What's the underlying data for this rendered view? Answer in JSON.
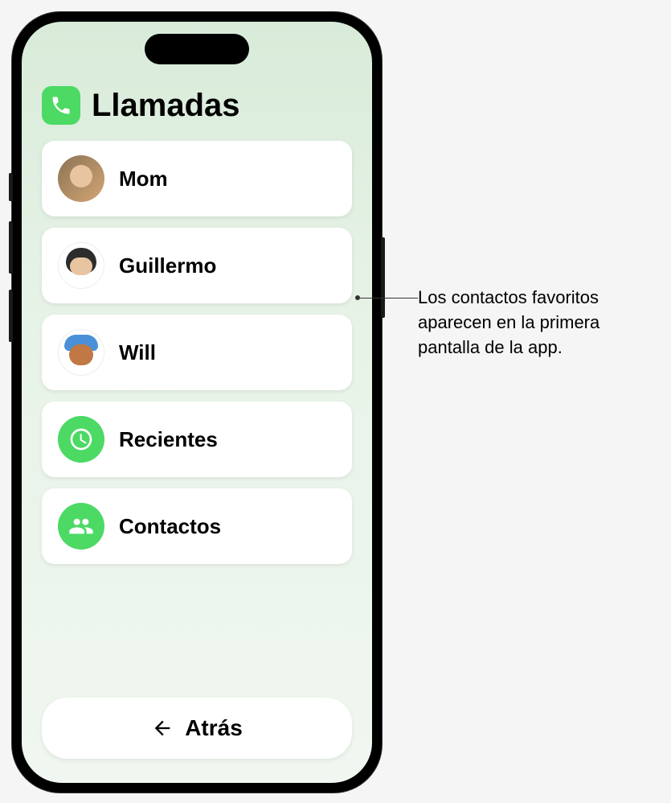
{
  "header": {
    "title": "Llamadas"
  },
  "favorites": [
    {
      "name": "Mom",
      "avatar_type": "photo"
    },
    {
      "name": "Guillermo",
      "avatar_type": "memoji"
    },
    {
      "name": "Will",
      "avatar_type": "memoji"
    }
  ],
  "actions": {
    "recents": {
      "label": "Recientes",
      "icon": "clock"
    },
    "contacts": {
      "label": "Contactos",
      "icon": "people"
    }
  },
  "back": {
    "label": "Atrás"
  },
  "callout": {
    "text": "Los contactos favoritos aparecen en la primera pantalla de la app."
  },
  "colors": {
    "accent_green": "#4cd964",
    "screen_bg": "#d8ebd9"
  }
}
